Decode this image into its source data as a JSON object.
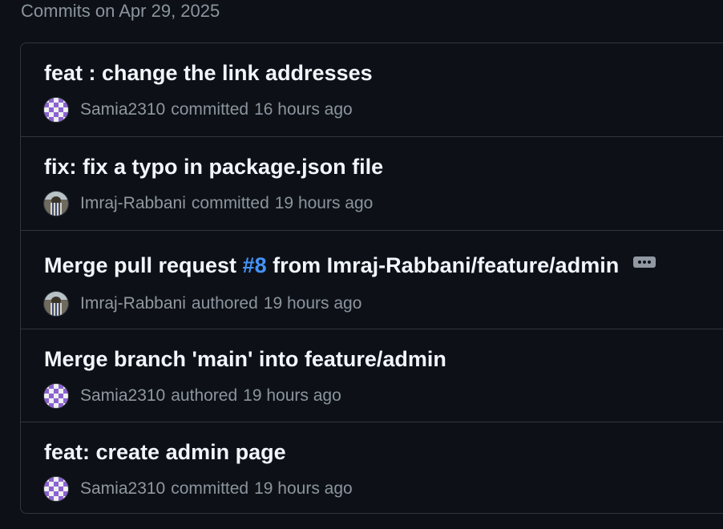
{
  "group_heading": "Commits on Apr 29, 2025",
  "commits": [
    {
      "title": "feat : change the link addresses",
      "author": "Samia2310",
      "action": "committed",
      "time": "16 hours ago",
      "avatar": "identicon-purple"
    },
    {
      "title": "fix: fix a typo in package.json file",
      "author": "Imraj-Rabbani",
      "action": "committed",
      "time": "19 hours ago",
      "avatar": "photo-avatar"
    },
    {
      "title_prefix": "Merge pull request ",
      "pr_number": "#8",
      "title_suffix": " from Imraj-Rabbani/feature/admin",
      "author": "Imraj-Rabbani",
      "action": "authored",
      "time": "19 hours ago",
      "avatar": "photo-avatar",
      "more_icon": "ellipsis-icon"
    },
    {
      "title": "Merge branch 'main' into feature/admin",
      "author": "Samia2310",
      "action": "authored",
      "time": "19 hours ago",
      "avatar": "identicon-purple"
    },
    {
      "title": "feat: create admin page",
      "author": "Samia2310",
      "action": "committed",
      "time": "19 hours ago",
      "avatar": "identicon-purple"
    }
  ],
  "colors": {
    "background": "#0d1117",
    "border": "#30363d",
    "title": "#f0f6fc",
    "muted": "#8b949e",
    "link": "#4493f8",
    "identicon": "#8a63d2"
  }
}
